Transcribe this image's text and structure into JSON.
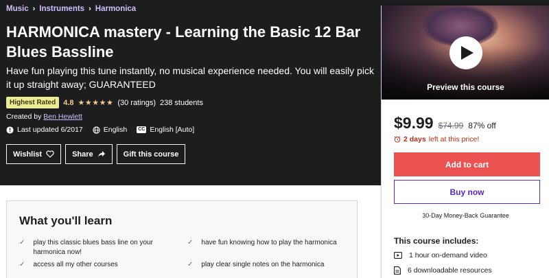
{
  "breadcrumb": [
    "Music",
    "Instruments",
    "Harmonica"
  ],
  "course": {
    "title": "HARMONICA mastery - Learning the Basic 12 Bar Blues Bassline",
    "subtitle": "Have fun playing this tune instantly, no musical experience needed. You will easily pick it up straight away; GUARANTEED",
    "badge": "Highest Rated",
    "rating": "4.8",
    "stars": "★★★★★",
    "ratings_count": "(30 ratings)",
    "students": "238 students",
    "created_by_label": "Created by",
    "instructor": "Ben Hewlett",
    "last_updated": "Last updated 6/2017",
    "language": "English",
    "captions": "English [Auto]",
    "captions_icon_text": "CC"
  },
  "actions": {
    "wishlist": "Wishlist",
    "share": "Share",
    "gift": "Gift this course"
  },
  "learn": {
    "title": "What you'll learn",
    "items": [
      "play this classic blues bass line on your harmonica now!",
      "have fun knowing how to play the harmonica",
      "access all my other courses",
      "play clear single notes on the harmonica"
    ]
  },
  "sidebar": {
    "preview_label": "Preview this course",
    "price": "$9.99",
    "original_price": "$74.99",
    "discount": "87% off",
    "timer_bold": "2 days",
    "timer_rest": "left at this price!",
    "add_to_cart": "Add to cart",
    "buy_now": "Buy now",
    "guarantee": "30-Day Money-Back Guarantee",
    "includes_title": "This course includes:",
    "includes": [
      "1 hour on-demand video",
      "6 downloadable resources"
    ]
  },
  "colors": {
    "hero_bg": "#1c1d1f",
    "breadcrumb": "#cec0fc",
    "badge_bg": "#eceb98",
    "rating": "#f3ca8c",
    "add_to_cart": "#ec5252",
    "buy_now_border": "#5624d0",
    "timer": "#b32d0f"
  },
  "icons": [
    "alert-badge-icon",
    "globe-icon",
    "closed-captions-icon",
    "heart-icon",
    "share-arrow-icon",
    "play-icon",
    "alarm-clock-icon",
    "checkmark-icon",
    "video-icon",
    "file-icon"
  ]
}
